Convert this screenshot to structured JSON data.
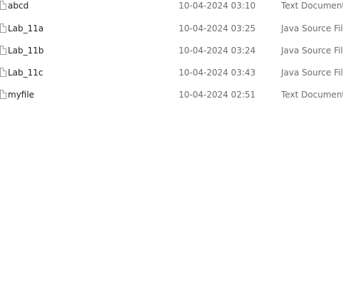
{
  "files": [
    {
      "name": "abcd",
      "modified": "10-04-2024 03:10",
      "type": "Text Document",
      "icon": "file-icon"
    },
    {
      "name": "Lab_11a",
      "modified": "10-04-2024 03:25",
      "type": "Java Source File",
      "icon": "file-icon"
    },
    {
      "name": "Lab_11b",
      "modified": "10-04-2024 03:24",
      "type": "Java Source File",
      "icon": "file-icon"
    },
    {
      "name": "Lab_11c",
      "modified": "10-04-2024 03:43",
      "type": "Java Source File",
      "icon": "file-icon"
    },
    {
      "name": "myfile",
      "modified": "10-04-2024 02:51",
      "type": "Text Document",
      "icon": "file-icon"
    }
  ]
}
